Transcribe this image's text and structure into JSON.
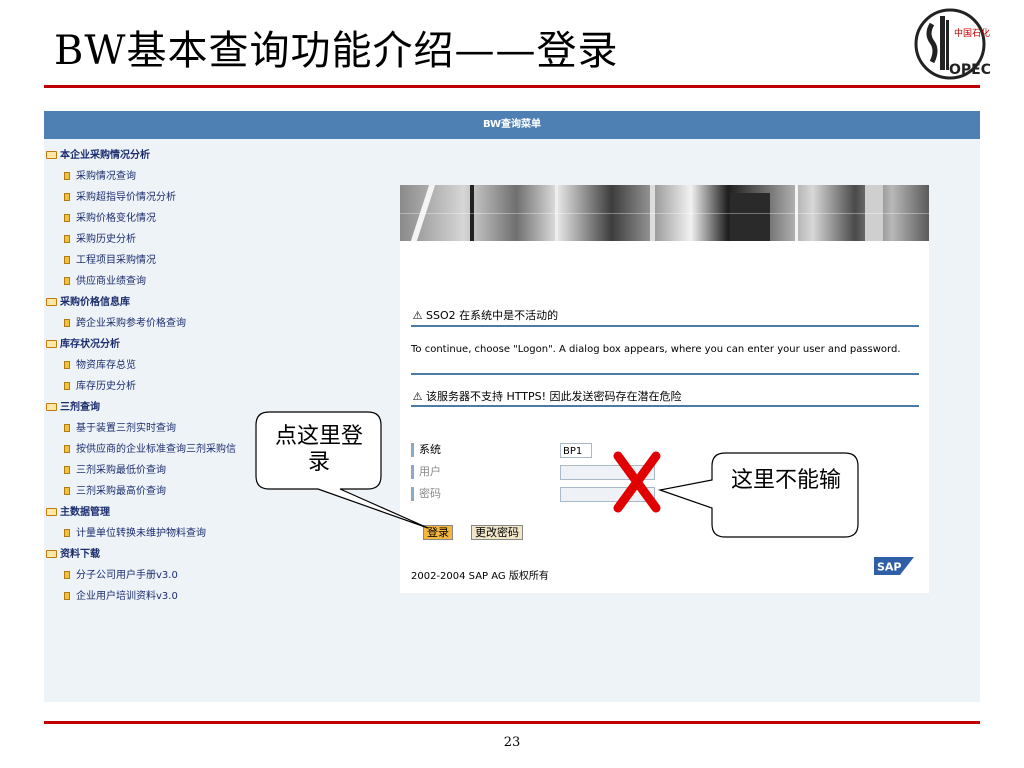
{
  "slide": {
    "title": "BW基本查询功能介绍——登录",
    "page_number": "23"
  },
  "logo": {
    "text": "SINOPEC",
    "alt": "中国石化"
  },
  "menu": {
    "header": "BW查询菜单",
    "folders": [
      {
        "label": "本企业采购情况分析",
        "items": [
          "采购情况查询",
          "采购超指导价情况分析",
          "采购价格变化情况",
          "采购历史分析",
          "工程项目采购情况",
          "供应商业绩查询"
        ]
      },
      {
        "label": "采购价格信息库",
        "items": [
          "跨企业采购参考价格查询"
        ]
      },
      {
        "label": "库存状况分析",
        "items": [
          "物资库存总览",
          "库存历史分析"
        ]
      },
      {
        "label": "三剂查询",
        "items": [
          "基于装置三剂实时查询",
          "按供应商的企业标准查询三剂采购信",
          "三剂采购最低价查询",
          "三剂采购最高价查询"
        ]
      },
      {
        "label": "主数据管理",
        "items": [
          "计量单位转换未维护物料查询"
        ]
      },
      {
        "label": "资料下载",
        "items": [
          "分子公司用户手册v3.0",
          "企业用户培训资料v3.0"
        ]
      }
    ]
  },
  "login": {
    "sso_warning": "SSO2 在系统中是不活动的",
    "info_text": "To continue, choose \"Logon\". A dialog box appears, where you can enter your user and password.",
    "https_warning": "该服务器不支持 HTTPS! 因此发送密码存在潜在危险",
    "fields": {
      "system_label": "系统",
      "system_value": "BP1",
      "user_label": "用户",
      "user_value": "",
      "password_label": "密码",
      "password_value": ""
    },
    "buttons": {
      "logon": "登录",
      "change_password": "更改密码"
    },
    "copyright": "2002-2004 SAP AG 版权所有",
    "sap_logo": "SAP"
  },
  "callouts": {
    "login_hint": "点这里登录",
    "no_input_hint": "这里不能输"
  },
  "colors": {
    "title_rule": "#c00000",
    "menu_header": "#4e80b3",
    "frame_bg": "#eef3f8",
    "cross": "#e00000",
    "logon_button": "#f4b73c"
  },
  "icons": [
    "folder-icon",
    "document-icon",
    "warning-icon",
    "cross-icon"
  ]
}
